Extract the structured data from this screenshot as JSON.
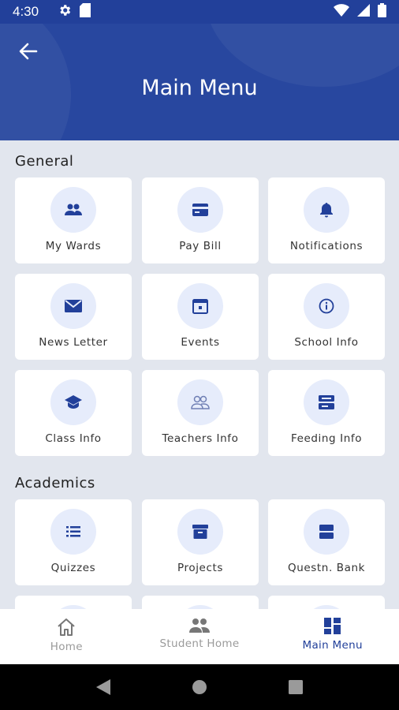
{
  "status_bar": {
    "time": "4:30"
  },
  "header": {
    "title": "Main Menu"
  },
  "sections": [
    {
      "title": "General",
      "items": [
        {
          "label": "My Wards",
          "icon": "users-icon"
        },
        {
          "label": "Pay Bill",
          "icon": "credit-card-icon"
        },
        {
          "label": "Notifications",
          "icon": "bell-icon"
        },
        {
          "label": "News Letter",
          "icon": "envelope-icon"
        },
        {
          "label": "Events",
          "icon": "calendar-icon"
        },
        {
          "label": "School Info",
          "icon": "info-icon"
        },
        {
          "label": "Class Info",
          "icon": "graduation-cap-icon"
        },
        {
          "label": "Teachers Info",
          "icon": "people-outline-icon"
        },
        {
          "label": "Feeding Info",
          "icon": "food-tray-icon"
        }
      ]
    },
    {
      "title": "Academics",
      "items": [
        {
          "label": "Quizzes",
          "icon": "list-icon"
        },
        {
          "label": "Projects",
          "icon": "archive-box-icon"
        },
        {
          "label": "Questn. Bank",
          "icon": "database-icon"
        }
      ]
    }
  ],
  "bottom_nav": [
    {
      "label": "Home",
      "icon": "home-icon"
    },
    {
      "label": "Student Home",
      "icon": "users-icon"
    },
    {
      "label": "Main Menu",
      "icon": "grid-menu-icon",
      "active": true
    }
  ],
  "colors": {
    "primary": "#22409a",
    "header": "#28479f",
    "icon_bg": "#e6ecfb",
    "background": "#e2e6ee"
  }
}
